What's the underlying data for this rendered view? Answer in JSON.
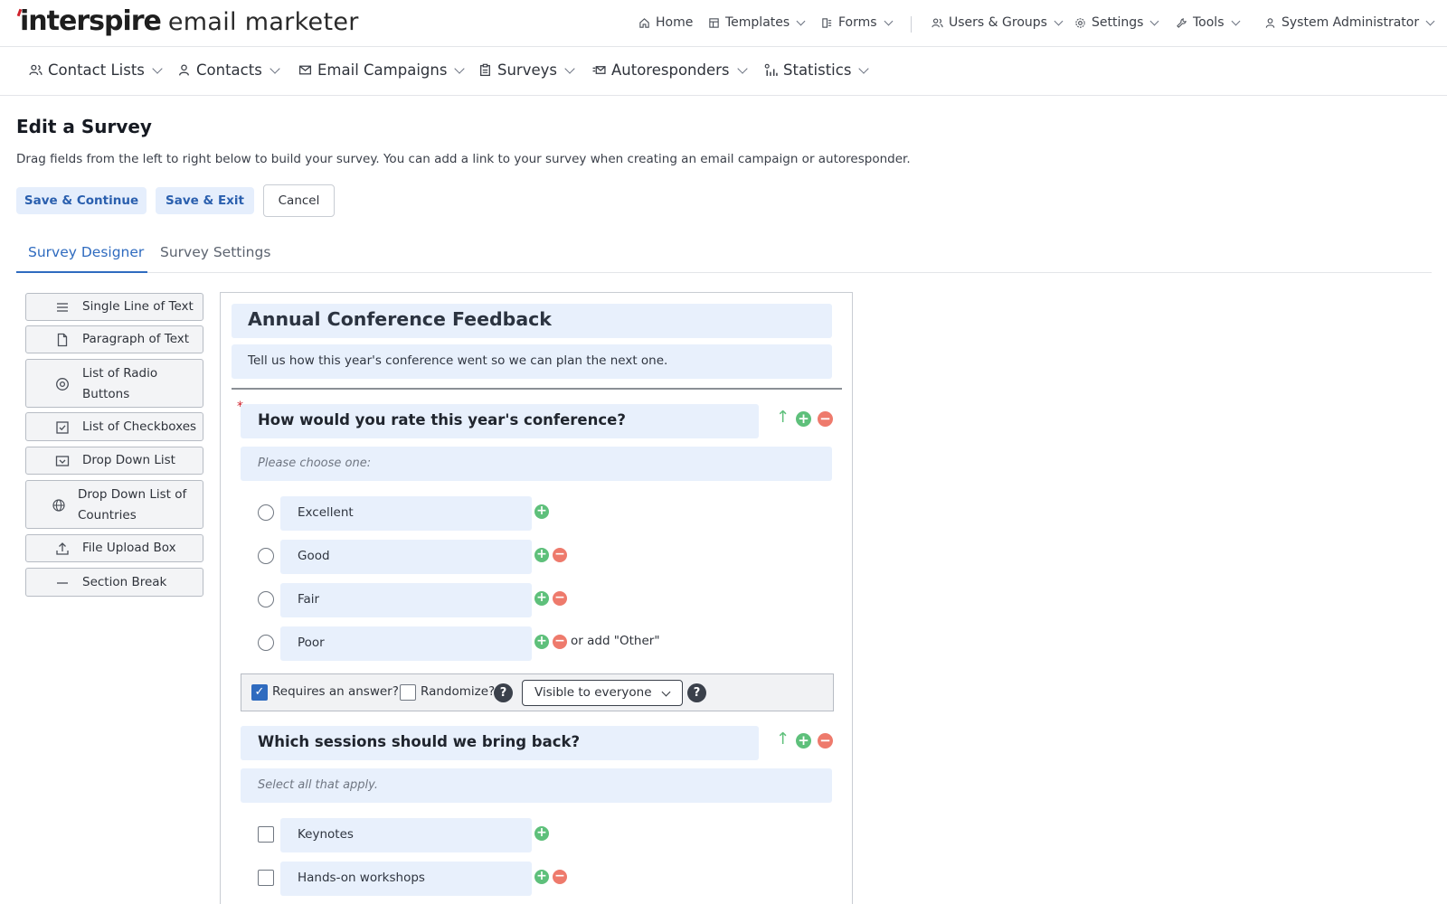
{
  "brand": {
    "name": "interspire",
    "product": "email marketer",
    "accent": "#d0212b"
  },
  "topnav": {
    "home": "Home",
    "templates": "Templates",
    "forms": "Forms",
    "users_groups": "Users & Groups",
    "settings": "Settings",
    "tools": "Tools",
    "user": "System Administrator"
  },
  "mainnav": {
    "contact_lists": "Contact Lists",
    "contacts": "Contacts",
    "email_campaigns": "Email Campaigns",
    "surveys": "Surveys",
    "autoresponders": "Autoresponders",
    "statistics": "Statistics"
  },
  "page": {
    "title": "Edit a Survey",
    "description": "Drag fields from the left to right below to build your survey. You can add a link to your survey when creating an email campaign or autoresponder."
  },
  "actions": {
    "save_continue": "Save & Continue",
    "save_exit": "Save & Exit",
    "cancel": "Cancel"
  },
  "tabs": {
    "designer": "Survey Designer",
    "settings": "Survey Settings"
  },
  "palette": {
    "single_line": "Single Line of Text",
    "paragraph": "Paragraph of Text",
    "radio_1": "List of Radio",
    "radio_2": "Buttons",
    "checkboxes": "List of Checkboxes",
    "dropdown": "Drop Down List",
    "countries_1": "Drop Down List of",
    "countries_2": "Countries",
    "file_upload": "File Upload Box",
    "section_break": "Section Break"
  },
  "survey": {
    "title": "Annual Conference Feedback",
    "description": "Tell us how this year's conference went so we can plan the next one.",
    "required_mark": "*",
    "q1": {
      "title": "How would you rate this year's conference?",
      "subtitle": "Please choose one:",
      "options": [
        "Excellent",
        "Good",
        "Fair",
        "Poor"
      ],
      "other": "or add \"Other\""
    },
    "q1_options_bar": {
      "requires_answer": "Requires an answer?",
      "requires_answer_checked": true,
      "randomize": "Randomize?",
      "randomize_checked": false,
      "help": "?",
      "visibility": "Visible to everyone"
    },
    "q2": {
      "title": "Which sessions should we bring back?",
      "subtitle": "Select all that apply.",
      "options": [
        "Keynotes",
        "Hands-on workshops"
      ]
    }
  },
  "colors": {
    "accent": "#2f6bbf",
    "field_bg": "#e8f0fc",
    "add": "#5ec07b",
    "remove": "#ee7a6c"
  }
}
